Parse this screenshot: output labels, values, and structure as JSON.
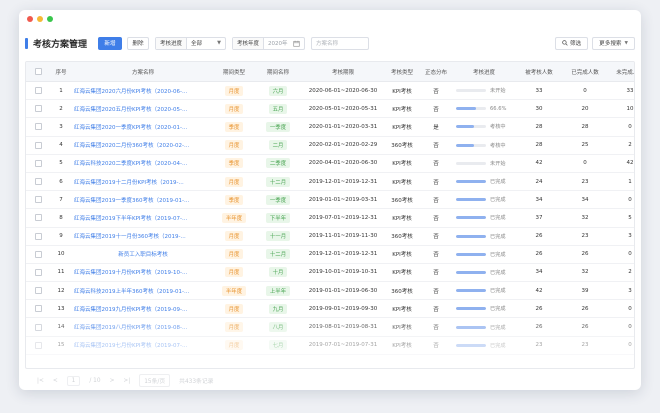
{
  "window": {
    "title": "考核方案管理"
  },
  "toolbar": {
    "new_label": "新增",
    "delete_label": "删除",
    "progress_filter": {
      "label": "考核进度",
      "value": "全部"
    },
    "year_filter": {
      "label": "考核年度",
      "value": "2020年"
    },
    "search_placeholder": "方案名称",
    "filter_label": "筛选",
    "more_search_label": "更多搜索"
  },
  "table": {
    "headers": {
      "no": "序号",
      "name": "方案名称",
      "ptype": "期间类型",
      "pname": "期间名称",
      "range": "考核期限",
      "type": "考核类型",
      "dist": "正态分布",
      "prog": "考核进度",
      "n1": "被考核人数",
      "n2": "已完成人数",
      "n3": "未完成人数"
    },
    "rows": [
      {
        "no": "1",
        "name": "红海云集团2020六月份KPI考核（2020-06-...",
        "ptype": "月度",
        "pname": "六月",
        "range": "2020-06-01~2020-06-30",
        "type": "KPI考核",
        "dist": "否",
        "prog_text": "未开始",
        "prog": 0,
        "n1": "33",
        "n2": "0",
        "n3": "33"
      },
      {
        "no": "2",
        "name": "红海云集团2020五月份KPI考核（2020-05-...",
        "ptype": "月度",
        "pname": "五月",
        "range": "2020-05-01~2020-05-31",
        "type": "KPI考核",
        "dist": "否",
        "prog_text": "66.6%",
        "prog": 66.6,
        "n1": "30",
        "n2": "20",
        "n3": "10"
      },
      {
        "no": "3",
        "name": "红海云集团2020一季度KPI考核（2020-01-...",
        "ptype": "季度",
        "pname": "一季度",
        "range": "2020-01-01~2020-03-31",
        "type": "KPI考核",
        "dist": "是",
        "prog_text": "考核中",
        "prog": 60,
        "n1": "28",
        "n2": "28",
        "n3": "0"
      },
      {
        "no": "4",
        "name": "红海云集团2020二月份360考核（2020-02-...",
        "ptype": "月度",
        "pname": "二月",
        "range": "2020-02-01~2020-02-29",
        "type": "360考核",
        "dist": "否",
        "prog_text": "考核中",
        "prog": 60,
        "n1": "28",
        "n2": "25",
        "n3": "2"
      },
      {
        "no": "5",
        "name": "红海云科技2020二季度KPI考核（2020-04-...",
        "ptype": "季度",
        "pname": "二季度",
        "range": "2020-04-01~2020-06-30",
        "type": "KPI考核",
        "dist": "否",
        "prog_text": "未开始",
        "prog": 0,
        "n1": "42",
        "n2": "0",
        "n3": "42"
      },
      {
        "no": "6",
        "name": "红海云集团2019十二月份KPI考核（2019-...",
        "ptype": "月度",
        "pname": "十二月",
        "range": "2019-12-01~2019-12-31",
        "type": "KPI考核",
        "dist": "否",
        "prog_text": "已完成",
        "prog": 100,
        "n1": "24",
        "n2": "23",
        "n3": "1"
      },
      {
        "no": "7",
        "name": "红海云集团2019一季度360考核（2019-01-...",
        "ptype": "季度",
        "pname": "一季度",
        "range": "2019-01-01~2019-03-31",
        "type": "360考核",
        "dist": "否",
        "prog_text": "已完成",
        "prog": 100,
        "n1": "34",
        "n2": "34",
        "n3": "0"
      },
      {
        "no": "8",
        "name": "红海云集团2019下半年KPI考核（2019-07-...",
        "ptype": "半年度",
        "pname": "下半年",
        "range": "2019-07-01~2019-12-31",
        "type": "KPI考核",
        "dist": "否",
        "prog_text": "已完成",
        "prog": 100,
        "n1": "37",
        "n2": "32",
        "n3": "5"
      },
      {
        "no": "9",
        "name": "红海云集团2019十一月份360考核（2019-...",
        "ptype": "月度",
        "pname": "十一月",
        "range": "2019-11-01~2019-11-30",
        "type": "360考核",
        "dist": "否",
        "prog_text": "已完成",
        "prog": 100,
        "n1": "26",
        "n2": "23",
        "n3": "3"
      },
      {
        "no": "10",
        "name": "新员工入职目标考核",
        "ptype": "月度",
        "pname": "十二月",
        "range": "2019-12-01~2019-12-31",
        "type": "KPI考核",
        "dist": "否",
        "prog_text": "已完成",
        "prog": 100,
        "n1": "26",
        "n2": "26",
        "n3": "0",
        "center": true
      },
      {
        "no": "11",
        "name": "红海云集团2019十月份KPI考核（2019-10-...",
        "ptype": "月度",
        "pname": "十月",
        "range": "2019-10-01~2019-10-31",
        "type": "KPI考核",
        "dist": "否",
        "prog_text": "已完成",
        "prog": 100,
        "n1": "34",
        "n2": "32",
        "n3": "2"
      },
      {
        "no": "12",
        "name": "红海云科技2019上半年360考核（2019-01-...",
        "ptype": "半年度",
        "pname": "上半年",
        "range": "2019-01-01~2019-06-30",
        "type": "360考核",
        "dist": "否",
        "prog_text": "已完成",
        "prog": 100,
        "n1": "42",
        "n2": "39",
        "n3": "3"
      },
      {
        "no": "13",
        "name": "红海云集团2019九月份KPI考核（2019-09-...",
        "ptype": "月度",
        "pname": "九月",
        "range": "2019-09-01~2019-09-30",
        "type": "KPI考核",
        "dist": "否",
        "prog_text": "已完成",
        "prog": 100,
        "n1": "26",
        "n2": "26",
        "n3": "0"
      },
      {
        "no": "14",
        "name": "红海云集团2019八月份KPI考核（2019-08-...",
        "ptype": "月度",
        "pname": "八月",
        "range": "2019-08-01~2019-08-31",
        "type": "KPI考核",
        "dist": "否",
        "prog_text": "已完成",
        "prog": 100,
        "n1": "26",
        "n2": "26",
        "n3": "0",
        "fade": 1
      },
      {
        "no": "15",
        "name": "红海云集团2019七月份KPI考核（2019-07-...",
        "ptype": "月度",
        "pname": "七月",
        "range": "2019-07-01~2019-07-31",
        "type": "KPI考核",
        "dist": "否",
        "prog_text": "已完成",
        "prog": 100,
        "n1": "23",
        "n2": "23",
        "n3": "0",
        "fade": 2
      }
    ]
  },
  "pager": {
    "current": "1",
    "total": "/ 10",
    "page_size": "15条/页",
    "total_text": "共433条记录"
  },
  "colors": {
    "primary": "#3f7ee8",
    "orange_tag": "#e8932e",
    "green_tag": "#4aa553"
  }
}
